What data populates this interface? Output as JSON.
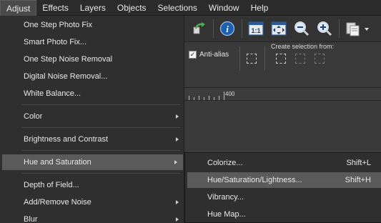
{
  "menubar": {
    "items": [
      "Adjust",
      "Effects",
      "Layers",
      "Objects",
      "Selections",
      "Window",
      "Help"
    ]
  },
  "adjust_menu": {
    "items": [
      {
        "label": "One Step Photo Fix",
        "submenu": false
      },
      {
        "label": "Smart Photo Fix...",
        "submenu": false
      },
      {
        "label": "One Step Noise Removal",
        "submenu": false
      },
      {
        "label": "Digital Noise Removal...",
        "submenu": false
      },
      {
        "label": "White Balance...",
        "submenu": false
      },
      {
        "label": "Color",
        "submenu": true
      },
      {
        "label": "Brightness and Contrast",
        "submenu": true
      },
      {
        "label": "Hue and Saturation",
        "submenu": true,
        "highlighted": true
      },
      {
        "label": "Depth of Field...",
        "submenu": false
      },
      {
        "label": "Add/Remove Noise",
        "submenu": true
      },
      {
        "label": "Blur",
        "submenu": true
      }
    ]
  },
  "hue_submenu": {
    "items": [
      {
        "label": "Colorize...",
        "shortcut": "Shift+L"
      },
      {
        "label": "Hue/Saturation/Lightness...",
        "shortcut": "Shift+H",
        "highlighted": true
      },
      {
        "label": "Vibrancy...",
        "shortcut": ""
      },
      {
        "label": "Hue Map...",
        "shortcut": ""
      }
    ]
  },
  "toolbar": {
    "antialias_label": "Anti-alias",
    "antialias_checked": true,
    "create_selection_label": "Create selection from:",
    "ruler_label": "400",
    "icons": [
      "redo-arrow-icon",
      "info-icon",
      "actual-size-icon",
      "fit-window-icon",
      "zoom-out-icon",
      "zoom-in-icon",
      "paste-icon"
    ]
  },
  "colors": {
    "menu_bg": "#2f2f2f",
    "highlight": "#5a5a5a",
    "info_blue": "#1e5fb0",
    "toolbar_bg": "#333333"
  }
}
